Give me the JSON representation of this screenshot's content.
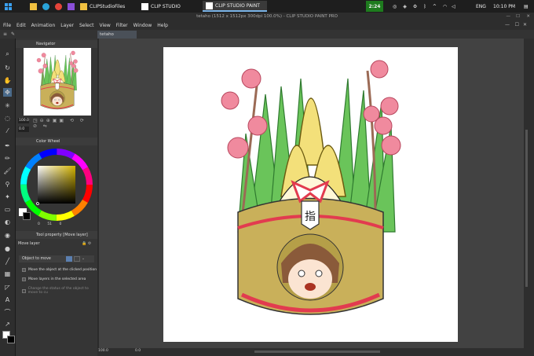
{
  "taskbar": {
    "apps": [
      {
        "label": "CLIPStudioFiles"
      },
      {
        "label": "CLIP STUDIO"
      },
      {
        "label": "CLIP STUDIO PAINT"
      }
    ],
    "timer": "2:24",
    "language": "ENG",
    "clock": "10:10 PM"
  },
  "window": {
    "title": "tetaho (1512 x 1512px 300dpi 100.0%) - CLIP STUDIO PAINT PRO",
    "tab": "tetaho"
  },
  "menu": [
    "File",
    "Edit",
    "Animation",
    "Layer",
    "Select",
    "View",
    "Filter",
    "Window",
    "Help"
  ],
  "navigator": {
    "title": "Navigator",
    "zoom": "100.0",
    "rotate": "0.0"
  },
  "color_wheel": {
    "title": "Color Wheel",
    "values": [
      "0",
      "51",
      "0"
    ]
  },
  "tool_property": {
    "title": "Tool property [Move layer]",
    "tool_name": "Move layer",
    "object_label": "Object to move",
    "options": [
      "Move the object at the clicked position",
      "Move layers in the selected area",
      "Change the status of the object to move to cu"
    ]
  },
  "status": {
    "zoom": "100.0",
    "angle": "0.0"
  },
  "stamp_text": "指",
  "colors": {
    "accent": "#1e7b1e",
    "gold": "#c9b05a",
    "red": "#e23b4f",
    "pink": "#f08a9e"
  }
}
